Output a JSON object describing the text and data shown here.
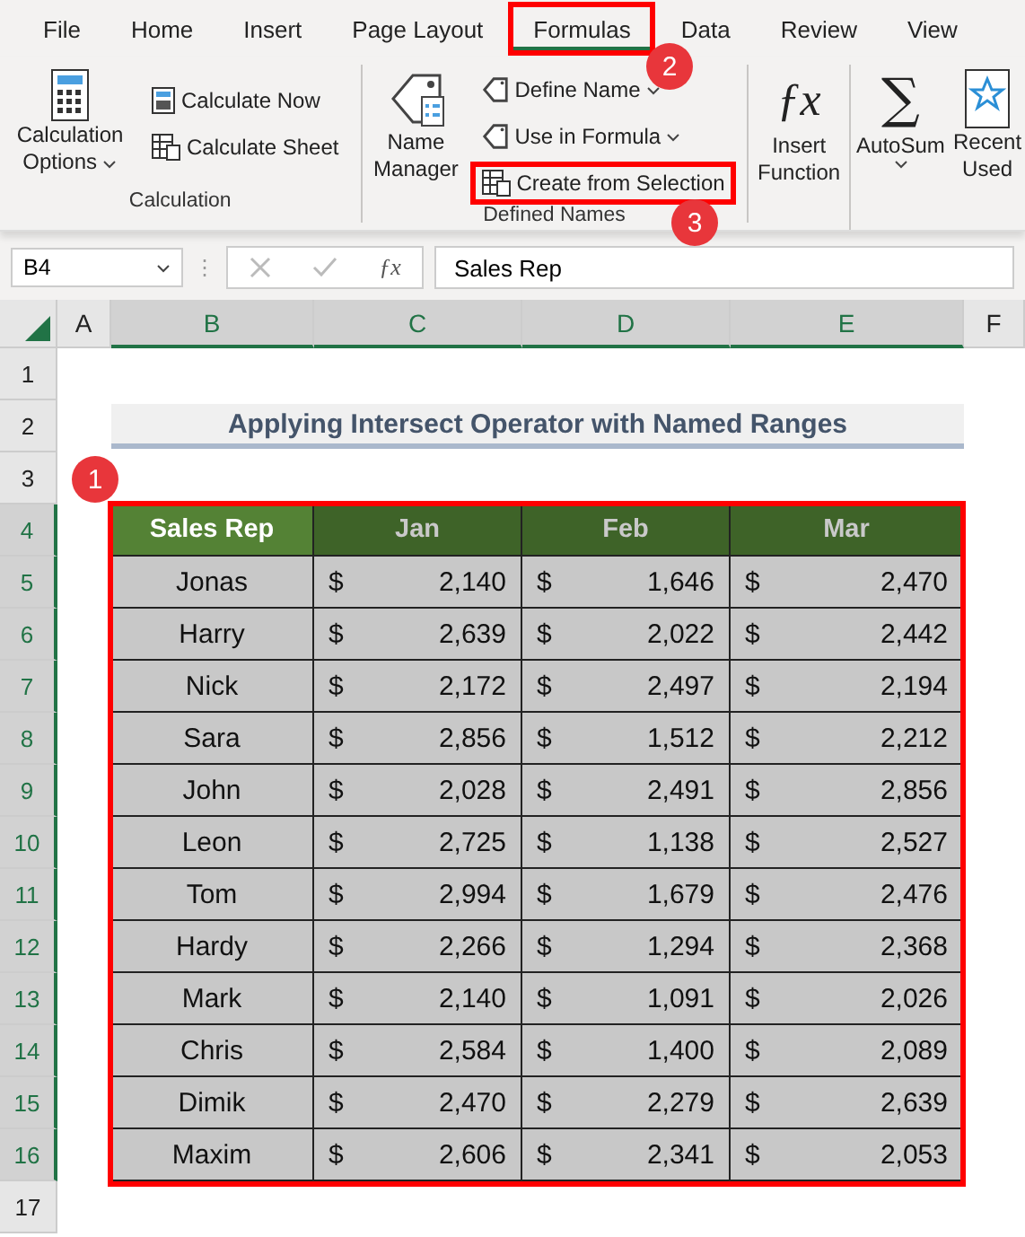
{
  "ribbon_tabs": [
    {
      "label": "File",
      "selected": false,
      "highlighted": false
    },
    {
      "label": "Home",
      "selected": false,
      "highlighted": false
    },
    {
      "label": "Insert",
      "selected": false,
      "highlighted": false
    },
    {
      "label": "Page Layout",
      "selected": false,
      "highlighted": false
    },
    {
      "label": "Formulas",
      "selected": true,
      "highlighted": true,
      "callout": "2"
    },
    {
      "label": "Data",
      "selected": false,
      "highlighted": false
    },
    {
      "label": "Review",
      "selected": false,
      "highlighted": false
    },
    {
      "label": "View",
      "selected": false,
      "highlighted": false
    }
  ],
  "ribbon": {
    "calculation": {
      "options": "Calculation Options",
      "calculate_now": "Calculate Now",
      "calculate_sheet": "Calculate Sheet",
      "group_label": "Calculation"
    },
    "defined_names": {
      "name_manager": "Name Manager",
      "define_name": "Define Name",
      "use_in_formula": "Use in Formula",
      "create_from_selection": {
        "label": "Create from Selection",
        "highlighted": true,
        "callout": "3"
      },
      "group_label": "Defined Names"
    },
    "insert_function_glyph": "ƒx",
    "insert_function": "Insert Function",
    "autosum_glyph": "∑",
    "autosum": "AutoSum",
    "recently_used": "Recent Used"
  },
  "formula_bar": {
    "name_box": "B4",
    "grip": "⋮",
    "fx": "ƒx",
    "value": "Sales Rep"
  },
  "columns": [
    {
      "label": "A",
      "selected": false
    },
    {
      "label": "B",
      "selected": true
    },
    {
      "label": "C",
      "selected": true
    },
    {
      "label": "D",
      "selected": true
    },
    {
      "label": "E",
      "selected": true
    },
    {
      "label": "F",
      "selected": false
    }
  ],
  "row_numbers": [
    {
      "label": "1",
      "selected": false
    },
    {
      "label": "2",
      "selected": false
    },
    {
      "label": "3",
      "selected": false
    },
    {
      "label": "4",
      "selected": true
    },
    {
      "label": "5",
      "selected": true
    },
    {
      "label": "6",
      "selected": true
    },
    {
      "label": "7",
      "selected": true
    },
    {
      "label": "8",
      "selected": true
    },
    {
      "label": "9",
      "selected": true
    },
    {
      "label": "10",
      "selected": true
    },
    {
      "label": "11",
      "selected": true
    },
    {
      "label": "12",
      "selected": true
    },
    {
      "label": "13",
      "selected": true
    },
    {
      "label": "14",
      "selected": true
    },
    {
      "label": "15",
      "selected": true
    },
    {
      "label": "16",
      "selected": true
    },
    {
      "label": "17",
      "selected": false
    }
  ],
  "title": "Applying Intersect Operator with Named Ranges",
  "table": {
    "highlighted": true,
    "callout": "1",
    "headers": [
      {
        "label": "Sales Rep",
        "active": true
      },
      {
        "label": "Jan",
        "active": false
      },
      {
        "label": "Feb",
        "active": false
      },
      {
        "label": "Mar",
        "active": false
      }
    ],
    "rows": [
      {
        "name": "Jonas",
        "values": [
          {
            "currency": "$",
            "amount": "2,140"
          },
          {
            "currency": "$",
            "amount": "1,646"
          },
          {
            "currency": "$",
            "amount": "2,470"
          }
        ]
      },
      {
        "name": "Harry",
        "values": [
          {
            "currency": "$",
            "amount": "2,639"
          },
          {
            "currency": "$",
            "amount": "2,022"
          },
          {
            "currency": "$",
            "amount": "2,442"
          }
        ]
      },
      {
        "name": "Nick",
        "values": [
          {
            "currency": "$",
            "amount": "2,172"
          },
          {
            "currency": "$",
            "amount": "2,497"
          },
          {
            "currency": "$",
            "amount": "2,194"
          }
        ]
      },
      {
        "name": "Sara",
        "values": [
          {
            "currency": "$",
            "amount": "2,856"
          },
          {
            "currency": "$",
            "amount": "1,512"
          },
          {
            "currency": "$",
            "amount": "2,212"
          }
        ]
      },
      {
        "name": "John",
        "values": [
          {
            "currency": "$",
            "amount": "2,028"
          },
          {
            "currency": "$",
            "amount": "2,491"
          },
          {
            "currency": "$",
            "amount": "2,856"
          }
        ]
      },
      {
        "name": "Leon",
        "values": [
          {
            "currency": "$",
            "amount": "2,725"
          },
          {
            "currency": "$",
            "amount": "1,138"
          },
          {
            "currency": "$",
            "amount": "2,527"
          }
        ]
      },
      {
        "name": "Tom",
        "values": [
          {
            "currency": "$",
            "amount": "2,994"
          },
          {
            "currency": "$",
            "amount": "1,679"
          },
          {
            "currency": "$",
            "amount": "2,476"
          }
        ]
      },
      {
        "name": "Hardy",
        "values": [
          {
            "currency": "$",
            "amount": "2,266"
          },
          {
            "currency": "$",
            "amount": "1,294"
          },
          {
            "currency": "$",
            "amount": "2,368"
          }
        ]
      },
      {
        "name": "Mark",
        "values": [
          {
            "currency": "$",
            "amount": "2,140"
          },
          {
            "currency": "$",
            "amount": "1,091"
          },
          {
            "currency": "$",
            "amount": "2,026"
          }
        ]
      },
      {
        "name": "Chris",
        "values": [
          {
            "currency": "$",
            "amount": "2,584"
          },
          {
            "currency": "$",
            "amount": "1,400"
          },
          {
            "currency": "$",
            "amount": "2,089"
          }
        ]
      },
      {
        "name": "Dimik",
        "values": [
          {
            "currency": "$",
            "amount": "2,470"
          },
          {
            "currency": "$",
            "amount": "2,279"
          },
          {
            "currency": "$",
            "amount": "2,639"
          }
        ]
      },
      {
        "name": "Maxim",
        "values": [
          {
            "currency": "$",
            "amount": "2,606"
          },
          {
            "currency": "$",
            "amount": "2,341"
          },
          {
            "currency": "$",
            "amount": "2,053"
          }
        ]
      }
    ]
  }
}
